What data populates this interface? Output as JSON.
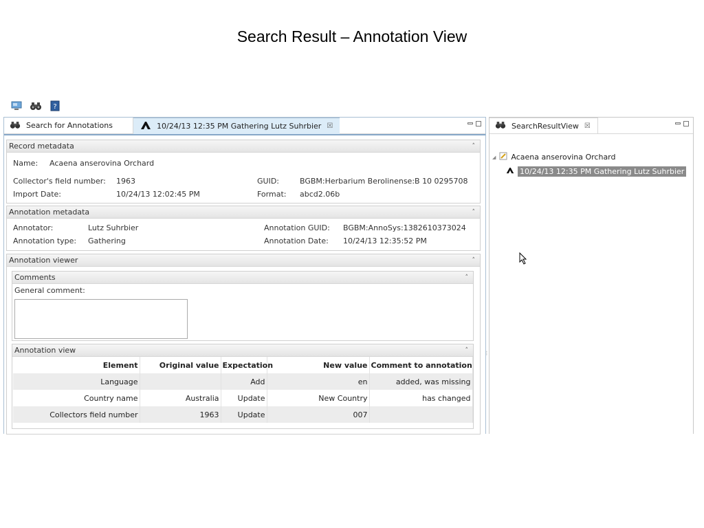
{
  "slide_title": "Search Result – Annotation View",
  "toolbar": {
    "icons": [
      "monitor-icon",
      "binoculars-icon",
      "help-book-icon"
    ]
  },
  "left_view": {
    "tabs": [
      {
        "label": "Search for Annotations",
        "icon": "binoculars-icon"
      },
      {
        "label": "10/24/13 12:35 PM Gathering Lutz Suhrbier",
        "icon": "annotation-a-icon",
        "close": "☒"
      }
    ]
  },
  "record_metadata": {
    "title": "Record metadata",
    "name_label": "Name:",
    "name_value": "Acaena anserovina Orchard",
    "collector_label": "Collector's field number:",
    "collector_value": "1963",
    "import_label": "Import Date:",
    "import_value": "10/24/13 12:02:45 PM",
    "guid_label": "GUID:",
    "guid_value": "BGBM:Herbarium Berolinense:B 10 0295708",
    "format_label": "Format:",
    "format_value": "abcd2.06b"
  },
  "annotation_metadata": {
    "title": "Annotation metadata",
    "annotator_label": "Annotator:",
    "annotator_value": "Lutz Suhrbier",
    "type_label": "Annotation type:",
    "type_value": "Gathering",
    "guid_label": "Annotation GUID:",
    "guid_value": "BGBM:AnnoSys:1382610373024",
    "date_label": "Annotation Date:",
    "date_value": "10/24/13 12:35:52 PM"
  },
  "annotation_viewer": {
    "title": "Annotation viewer",
    "comments": {
      "title": "Comments",
      "general_label": "General comment:",
      "general_value": ""
    },
    "annotation_view": {
      "title": "Annotation view",
      "columns": [
        "Element",
        "Original value",
        "Expectation",
        "New value",
        "Comment to annotation"
      ],
      "rows": [
        [
          "Language",
          "",
          "Add",
          "en",
          "added, was missing"
        ],
        [
          "Country name",
          "Australia",
          "Update",
          "New Country",
          "has changed"
        ],
        [
          "Collectors field number",
          "1963",
          "Update",
          "007",
          ""
        ]
      ]
    }
  },
  "right_view": {
    "tab_label": "SearchResultView",
    "tab_close": "☒",
    "tree": {
      "parent_label": "Acaena anserovina Orchard",
      "child_label": "10/24/13 12:35 PM Gathering Lutz Suhrbier"
    }
  },
  "collapse_glyph": "»"
}
